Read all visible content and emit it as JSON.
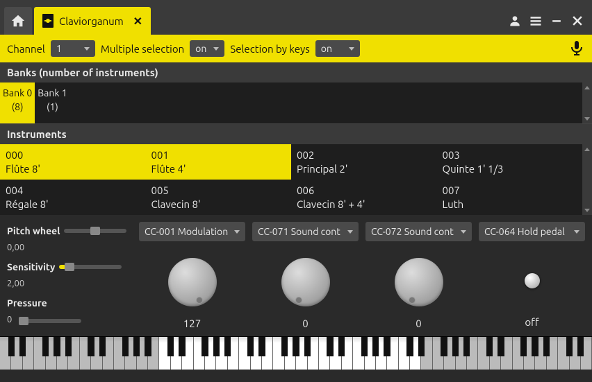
{
  "tab": {
    "title": "Claviorganum"
  },
  "toolbar": {
    "channel_label": "Channel",
    "channel_value": "1",
    "multisel_label": "Multiple selection",
    "multisel_value": "on",
    "selkeys_label": "Selection by keys",
    "selkeys_value": "on"
  },
  "banks": {
    "header": "Banks (number of instruments)",
    "items": [
      {
        "name": "Bank 0",
        "count": "(8)",
        "selected": true
      },
      {
        "name": "Bank 1",
        "count": "(1)",
        "selected": false
      }
    ]
  },
  "instruments": {
    "header": "Instruments",
    "items": [
      {
        "num": "000",
        "name": "Flûte 8'",
        "selected": true
      },
      {
        "num": "001",
        "name": "Flûte 4'",
        "selected": true
      },
      {
        "num": "002",
        "name": "Principal 2'",
        "selected": false
      },
      {
        "num": "003",
        "name": "Quinte 1' 1/3",
        "selected": false
      },
      {
        "num": "004",
        "name": "Régale 8'",
        "selected": false
      },
      {
        "num": "005",
        "name": "Clavecin 8'",
        "selected": false
      },
      {
        "num": "006",
        "name": "Clavecin 8' + 4'",
        "selected": false
      },
      {
        "num": "007",
        "name": "Luth",
        "selected": false
      }
    ]
  },
  "controls": {
    "pitch": {
      "label": "Pitch wheel",
      "value": "0,00"
    },
    "sensitivity": {
      "label": "Sensitivity",
      "value": "2,00"
    },
    "pressure": {
      "label": "Pressure",
      "value": "0"
    },
    "cc": [
      {
        "label": "CC-001 Modulation",
        "value": "127"
      },
      {
        "label": "CC-071 Sound cont",
        "value": "0"
      },
      {
        "label": "CC-072 Sound cont",
        "value": "0"
      },
      {
        "label": "CC-064 Hold pedal",
        "value": "off"
      }
    ]
  }
}
